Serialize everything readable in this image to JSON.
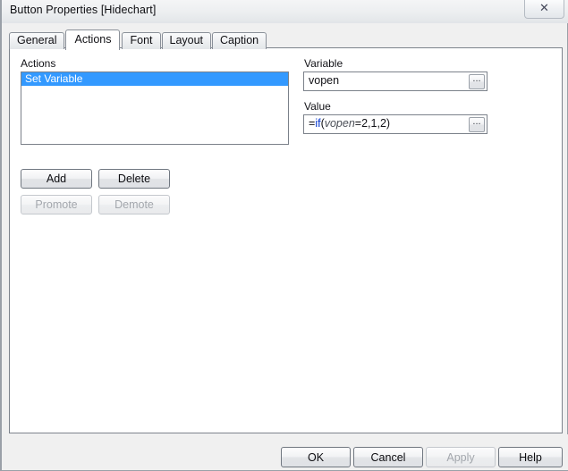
{
  "window": {
    "title": "Button Properties [Hidechart]",
    "close_label": "✕"
  },
  "tabs": [
    {
      "label": "General",
      "active": false
    },
    {
      "label": "Actions",
      "active": true
    },
    {
      "label": "Font",
      "active": false
    },
    {
      "label": "Layout",
      "active": false
    },
    {
      "label": "Caption",
      "active": false
    }
  ],
  "actions_panel": {
    "label": "Actions",
    "items": [
      {
        "label": "Set Variable",
        "selected": true
      }
    ],
    "buttons": {
      "add": "Add",
      "delete": "Delete",
      "promote": "Promote",
      "demote": "Demote"
    }
  },
  "properties_panel": {
    "variable_label": "Variable",
    "variable_value": "vopen",
    "variable_browse": "...",
    "value_label": "Value",
    "value_expression": "=if(vopen=2,1,2)",
    "value_tokens": {
      "prefix": "=",
      "function": "if",
      "open_paren": "(",
      "variable": "vopen",
      "suffix": "=2,1,2)"
    },
    "value_browse": "..."
  },
  "footer": {
    "ok": "OK",
    "cancel": "Cancel",
    "apply": "Apply",
    "help": "Help"
  },
  "colors": {
    "selection_blue": "#3399ff",
    "function_blue": "#0033cc",
    "variable_gray": "#4c5058",
    "window_gray": "#f0f0f0"
  }
}
